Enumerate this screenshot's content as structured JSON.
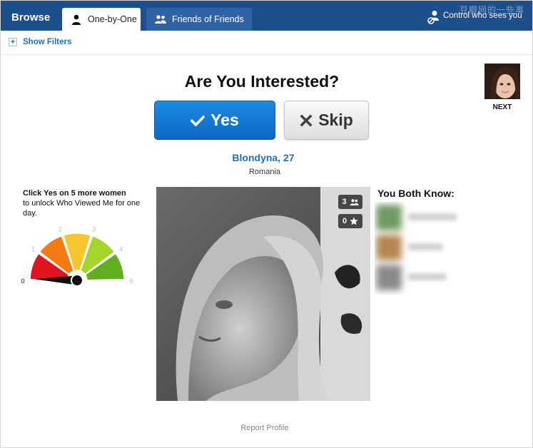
{
  "header": {
    "browse_label": "Browse",
    "tabs": [
      {
        "label": "One-by-One",
        "active": true
      },
      {
        "label": "Friends of Friends",
        "active": false
      }
    ],
    "control_label": "Control who sees you",
    "watermark": "豆瓣网的一些事"
  },
  "filters": {
    "show_filters_label": "Show Filters"
  },
  "main": {
    "question": "Are You Interested?",
    "yes_label": "Yes",
    "skip_label": "Skip",
    "profile_name": "Blondyna, 27",
    "profile_country": "Romania",
    "next_label": "NEXT",
    "photo_badges": {
      "friends_count": "3",
      "stars_count": "0"
    },
    "report_label": "Report Profile"
  },
  "unlock": {
    "bold_text": "Click Yes on 5 more women",
    "rest_text": "to unlock Who Viewed Me for one day.",
    "gauge_value": 0,
    "gauge_ticks": [
      "0",
      "1",
      "2",
      "3",
      "4",
      "5"
    ],
    "gauge_colors": [
      "#e0151f",
      "#f47b12",
      "#f7c52d",
      "#a5d42d",
      "#5faf1e"
    ]
  },
  "both_know": {
    "title": "You Both Know:"
  },
  "colors": {
    "header_bg": "#1c4f8b",
    "link_blue": "#1c6fbf",
    "yes_button": "#1c8ce3"
  }
}
